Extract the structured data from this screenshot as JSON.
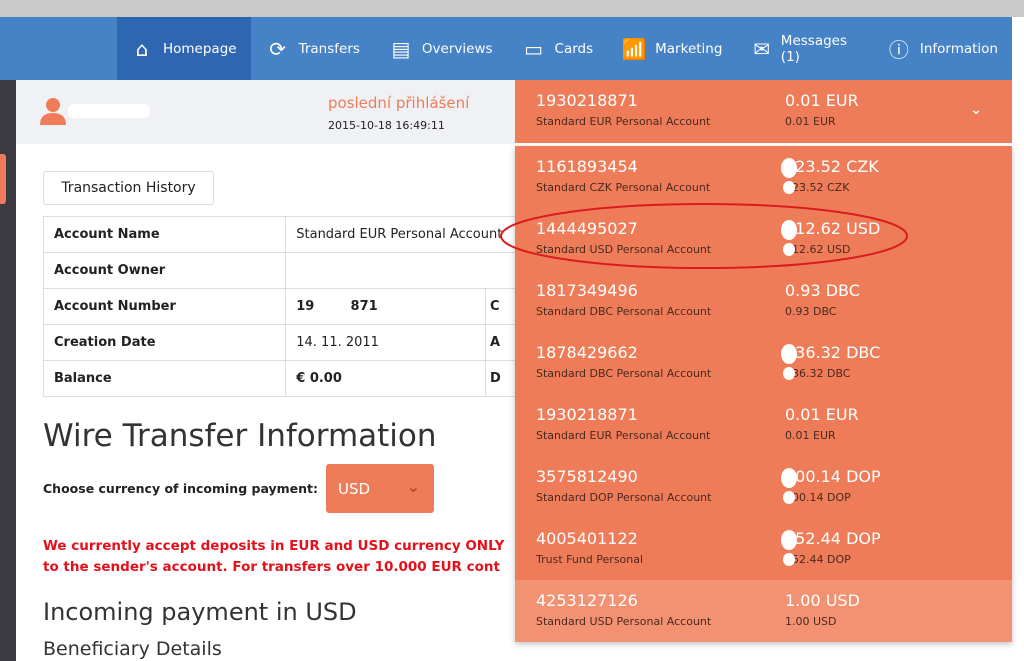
{
  "nav": {
    "items": [
      {
        "label": "Homepage",
        "icon": "home-icon",
        "active": true
      },
      {
        "label": "Transfers",
        "icon": "refresh-icon"
      },
      {
        "label": "Overviews",
        "icon": "overview-icon"
      },
      {
        "label": "Cards",
        "icon": "cards-icon"
      },
      {
        "label": "Marketing",
        "icon": "chart-icon"
      },
      {
        "label": "Messages (1)",
        "icon": "envelope-icon"
      },
      {
        "label": "Information",
        "icon": "info-icon"
      }
    ]
  },
  "user": {
    "last_login_label": "poslední přihlášení",
    "last_login_time": "2015-10-18 16:49:11"
  },
  "main": {
    "transaction_history": "Transaction History",
    "details": [
      {
        "label": "Account Name",
        "value": "Standard EUR Personal Account",
        "extra": ""
      },
      {
        "label": "Account Owner",
        "value": "",
        "extra": ""
      },
      {
        "label": "Account Number",
        "value": "19        871",
        "extra": "C"
      },
      {
        "label": "Creation Date",
        "value": "14. 11. 2011",
        "extra": "A"
      },
      {
        "label": "Balance",
        "value": "€ 0.00",
        "extra": "D"
      }
    ],
    "wire_title": "Wire Transfer Information",
    "choose_label": "Choose currency of incoming payment:",
    "currency": "USD",
    "warning_line1": "We currently accept deposits in EUR and USD currency ONLY",
    "warning_line2": "to the sender's account. For transfers over 10.000 EUR cont",
    "incoming_title": "Incoming payment in USD",
    "beneficiary_title": "Beneficiary Details"
  },
  "selected_account": {
    "number": "1930218871",
    "name": "Standard EUR Personal Account",
    "amount": "0.01 EUR",
    "amount_sub": "0.01 EUR"
  },
  "accounts": [
    {
      "number": "1161893454",
      "name": "Standard CZK Personal Account",
      "amount": "823.52 CZK",
      "amount_sub": "823.52 CZK",
      "redacted": true
    },
    {
      "number": "1444495027",
      "name": "Standard USD Personal Account",
      "amount": "412.62 USD",
      "amount_sub": "412.62 USD",
      "redacted": true
    },
    {
      "number": "1817349496",
      "name": "Standard DBC Personal Account",
      "amount": "0.93 DBC",
      "amount_sub": "0.93 DBC"
    },
    {
      "number": "1878429662",
      "name": "Standard DBC Personal Account",
      "amount": "036.32 DBC",
      "amount_sub": "036.32 DBC",
      "redacted": true
    },
    {
      "number": "1930218871",
      "name": "Standard EUR Personal Account",
      "amount": "0.01 EUR",
      "amount_sub": "0.01 EUR"
    },
    {
      "number": "3575812490",
      "name": "Standard DOP Personal Account",
      "amount": "000.14 DOP",
      "amount_sub": "000.14 DOP",
      "redacted": true
    },
    {
      "number": "4005401122",
      "name": "Trust Fund Personal",
      "amount": "452.44 DOP",
      "amount_sub": "452.44 DOP",
      "redacted": true
    },
    {
      "number": "4253127126",
      "name": "Standard USD Personal Account",
      "amount": "1.00 USD",
      "amount_sub": "1.00 USD"
    }
  ],
  "colors": {
    "nav": "#4582c6",
    "nav_active": "#2f66b1",
    "accent": "#ef7c58",
    "warning": "#e4101a",
    "annotation": "#d91c1c"
  }
}
